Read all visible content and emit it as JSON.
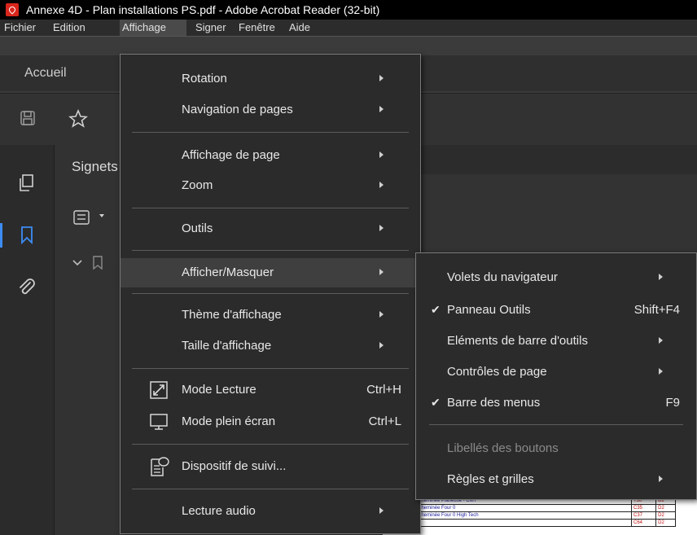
{
  "window": {
    "title": "Annexe 4D - Plan installations PS.pdf - Adobe Acrobat Reader (32-bit)"
  },
  "menubar": {
    "items": [
      "Fichier",
      "Edition",
      "Affichage",
      "Signer",
      "Fenêtre",
      "Aide"
    ]
  },
  "tabs": {
    "home": "Accueil"
  },
  "panel": {
    "title": "Signets"
  },
  "view_menu": {
    "items": [
      {
        "label": "Rotation"
      },
      {
        "label": "Navigation de pages"
      },
      {
        "label": "Affichage de page"
      },
      {
        "label": "Zoom"
      },
      {
        "label": "Outils"
      },
      {
        "label": "Afficher/Masquer"
      },
      {
        "label": "Thème d'affichage"
      },
      {
        "label": "Taille d'affichage"
      },
      {
        "label": "Mode Lecture",
        "shortcut": "Ctrl+H"
      },
      {
        "label": "Mode plein écran",
        "shortcut": "Ctrl+L"
      },
      {
        "label": "Dispositif de suivi..."
      },
      {
        "label": "Lecture audio"
      }
    ]
  },
  "show_hide_menu": {
    "items": [
      {
        "label": "Volets du navigateur"
      },
      {
        "label": "Panneau Outils",
        "shortcut": "Shift+F4",
        "checked": true
      },
      {
        "label": "Eléments de barre d'outils"
      },
      {
        "label": "Contrôles de page"
      },
      {
        "label": "Barre des menus",
        "shortcut": "F9",
        "checked": true
      },
      {
        "label": "Libellés des boutons",
        "disabled": true
      },
      {
        "label": "Règles et grilles"
      }
    ]
  },
  "document_rows": [
    {
      "name": "Cheminée Planeuse - CMT",
      "a": "T30",
      "b": "D2"
    },
    {
      "name": "Cheminée Four 0",
      "a": "C35",
      "b": "D2"
    },
    {
      "name": "Cheminée Four 0 High Tech",
      "a": "C37",
      "b": "D2"
    },
    {
      "name": "",
      "a": "C64",
      "b": "D2"
    }
  ]
}
